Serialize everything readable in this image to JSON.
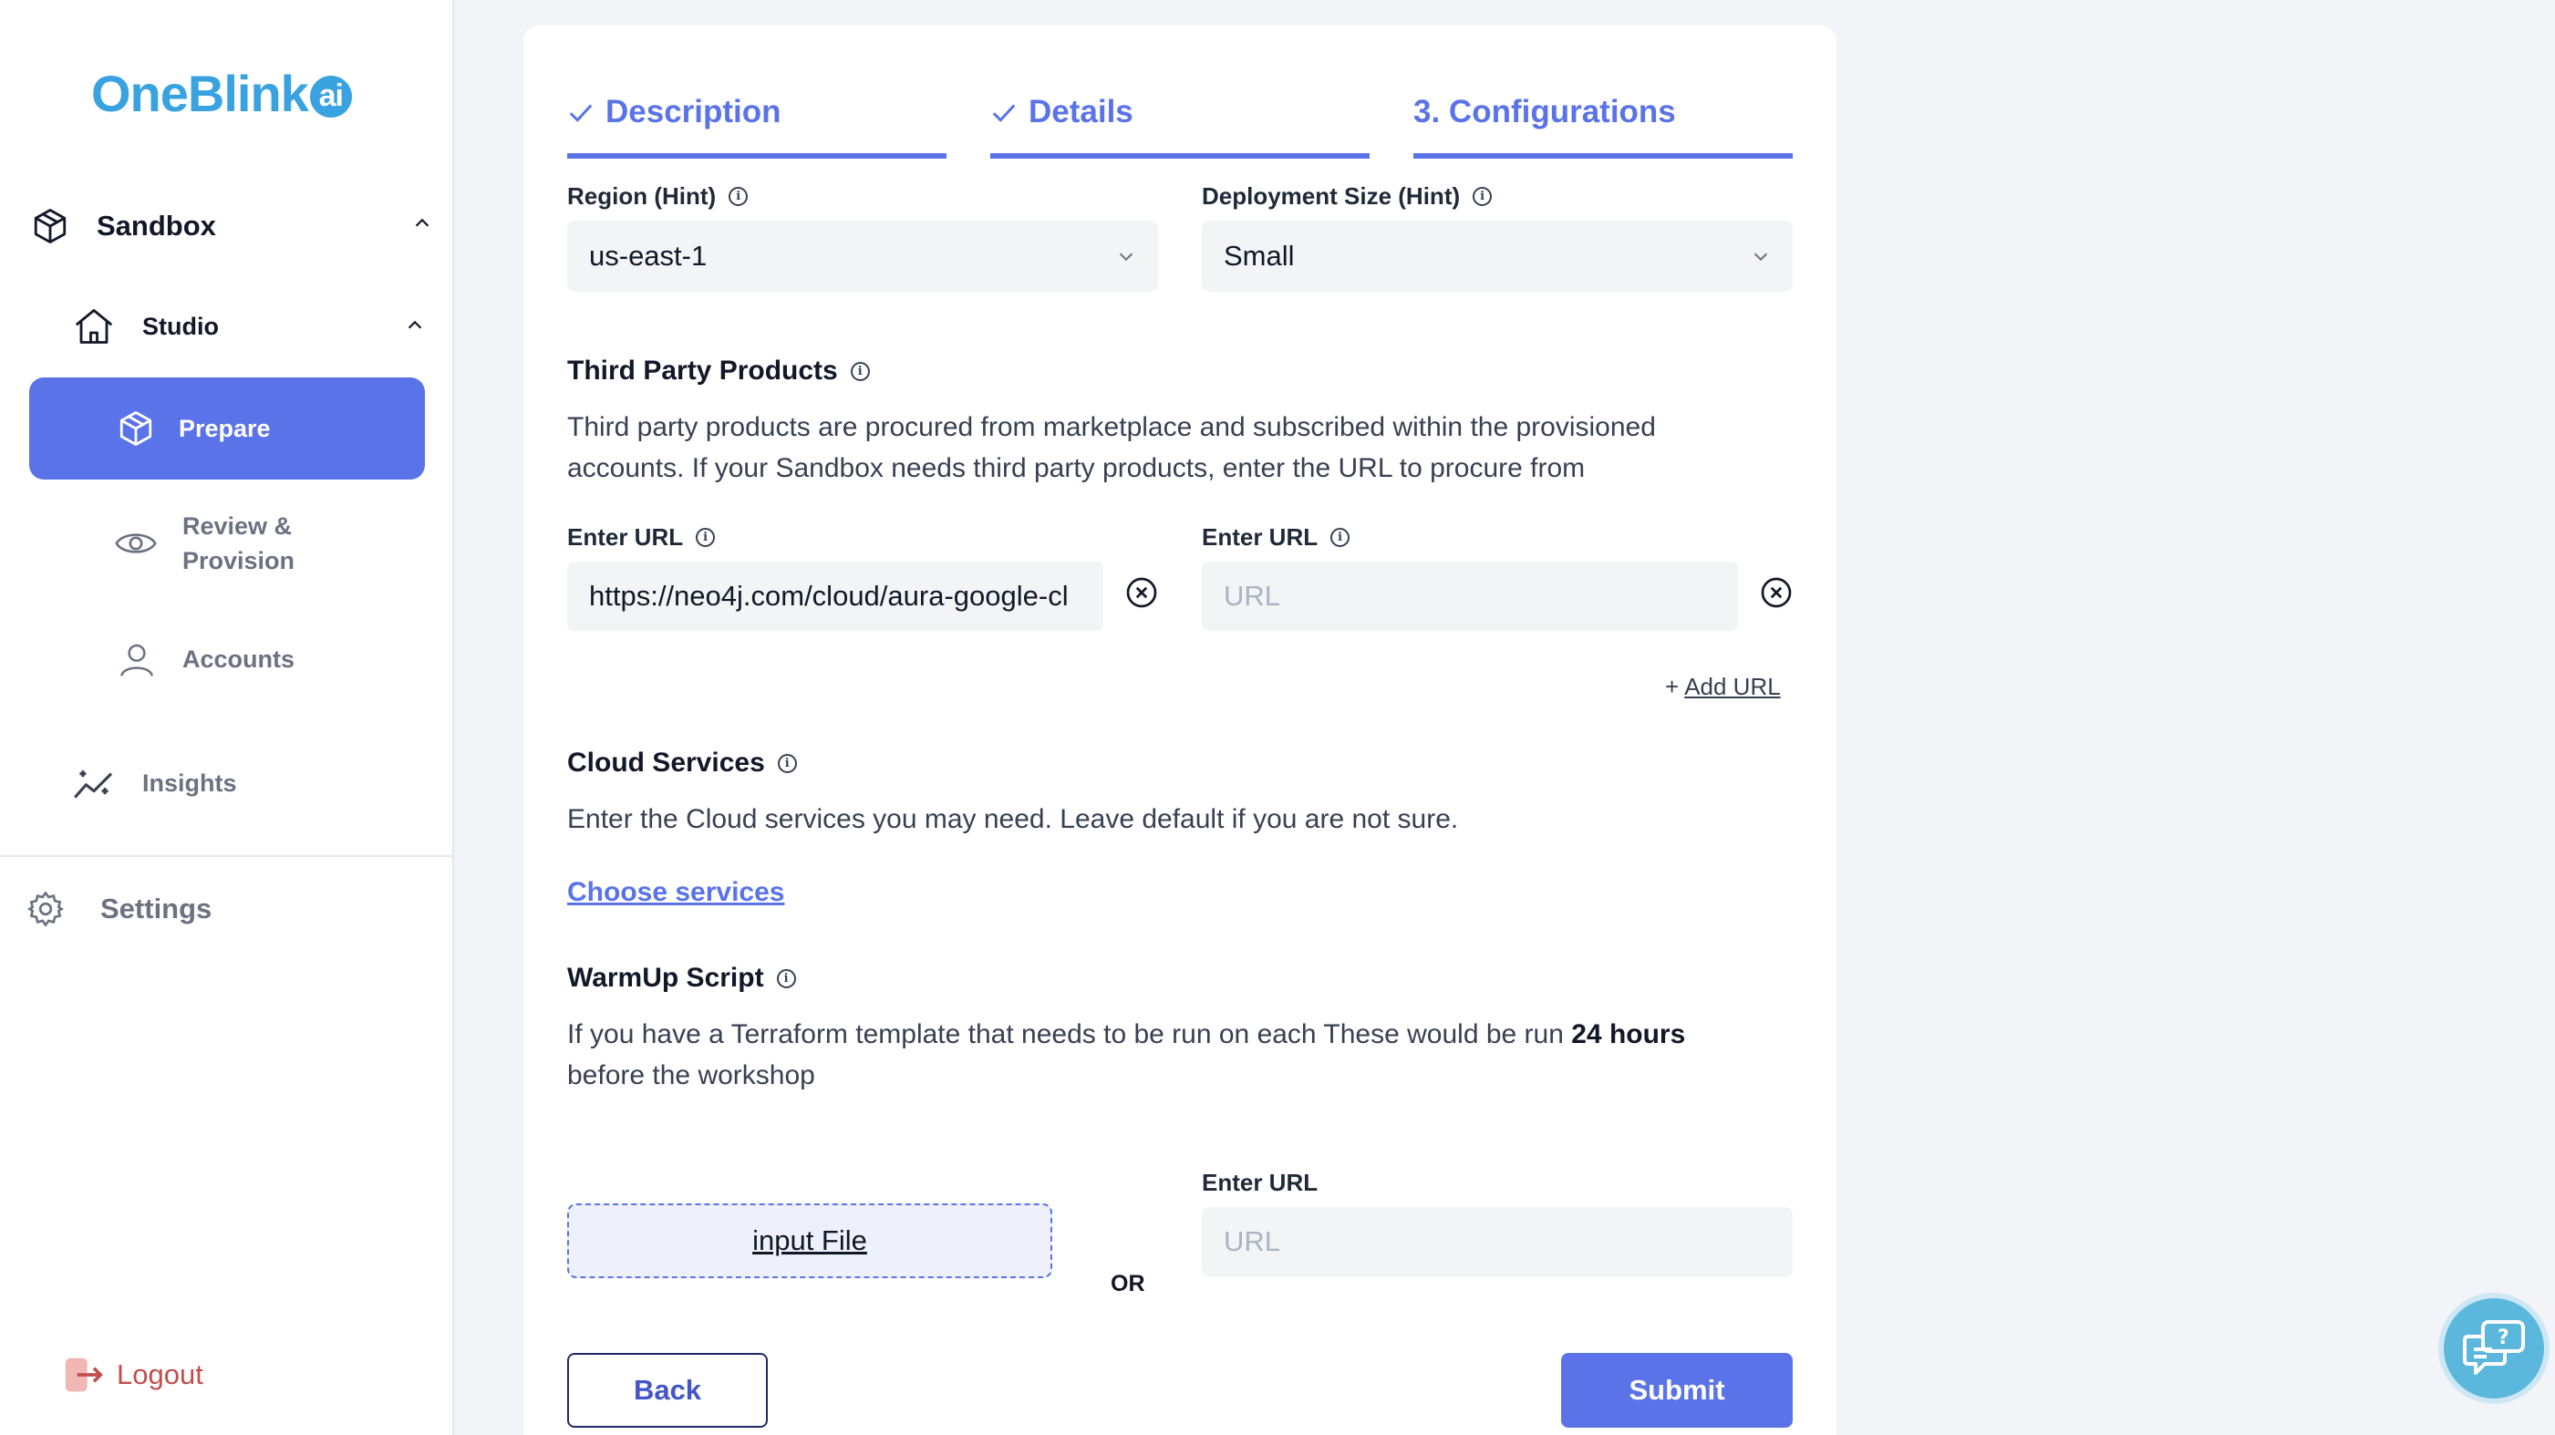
{
  "brand": {
    "name": "OneBlink",
    "badge": "ai"
  },
  "sidebar": {
    "sandbox_label": "Sandbox",
    "studio_label": "Studio",
    "items": [
      {
        "label": "Prepare",
        "icon": "cube-icon",
        "active": true
      },
      {
        "label": "Review & Provision",
        "icon": "eye-icon",
        "active": false
      },
      {
        "label": "Accounts",
        "icon": "user-icon",
        "active": false
      }
    ],
    "insights_label": "Insights",
    "settings_label": "Settings",
    "logout_label": "Logout"
  },
  "steps": [
    {
      "label": "Description",
      "done": true
    },
    {
      "label": "Details",
      "done": true
    },
    {
      "label": "3. Configurations",
      "done": false
    }
  ],
  "region": {
    "label": "Region (Hint)",
    "value": "us-east-1"
  },
  "deployment": {
    "label": "Deployment Size (Hint)",
    "value": "Small"
  },
  "third_party": {
    "title": "Third Party Products",
    "description_line1": "Third party products are procured from marketplace and subscribed within the provisioned",
    "description_line2": "accounts. If your Sandbox needs third party products, enter the URL to procure from",
    "url_label_1": "Enter URL",
    "url_value_1": "https://neo4j.com/cloud/aura-google-cl",
    "url_label_2": "Enter URL",
    "url_placeholder_2": "URL",
    "add_url_plus": "+",
    "add_url_label": "Add URL"
  },
  "cloud_services": {
    "title": "Cloud Services",
    "description": "Enter the Cloud services you may need. Leave default if you are not sure.",
    "link": "Choose services"
  },
  "warmup": {
    "title": "WarmUp Script",
    "description_pre": "If you have a Terraform template that needs to be run on each These would be run ",
    "description_bold": "24 hours",
    "description_line2": "before the workshop",
    "file_label": "input File",
    "or_label": "OR",
    "url_label": "Enter URL",
    "url_placeholder": "URL"
  },
  "buttons": {
    "back": "Back",
    "submit": "Submit"
  },
  "colors": {
    "accent": "#5a73e8",
    "brand": "#38a3e0",
    "logout": "#c0504d"
  }
}
